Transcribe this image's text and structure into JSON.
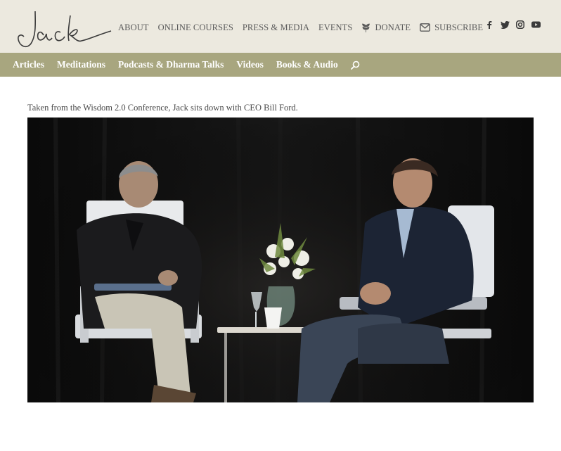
{
  "header": {
    "logo_text": "Jack",
    "nav": [
      {
        "label": "ABOUT",
        "icon": ""
      },
      {
        "label": "ONLINE COURSES",
        "icon": ""
      },
      {
        "label": "PRESS & MEDIA",
        "icon": ""
      },
      {
        "label": "EVENTS",
        "icon": ""
      },
      {
        "label": "DONATE",
        "icon": "leaf-icon"
      },
      {
        "label": "SUBSCRIBE",
        "icon": "envelope-icon"
      }
    ],
    "social": [
      "facebook-icon",
      "twitter-icon",
      "instagram-icon",
      "youtube-icon"
    ]
  },
  "subnav": {
    "items": [
      "Articles",
      "Meditations",
      "Podcasts & Dharma Talks",
      "Videos",
      "Books & Audio"
    ],
    "search_icon": "search-icon"
  },
  "main": {
    "caption": "Taken from the Wisdom 2.0 Conference, Jack sits down with CEO Bill Ford.",
    "video": {
      "kind": "embedded-video-frame"
    }
  },
  "colors": {
    "header_bg": "#ece9df",
    "subnav_bg": "#a8a67f",
    "text": "#4a4a4a",
    "nav_text": "#5a5a5a"
  }
}
